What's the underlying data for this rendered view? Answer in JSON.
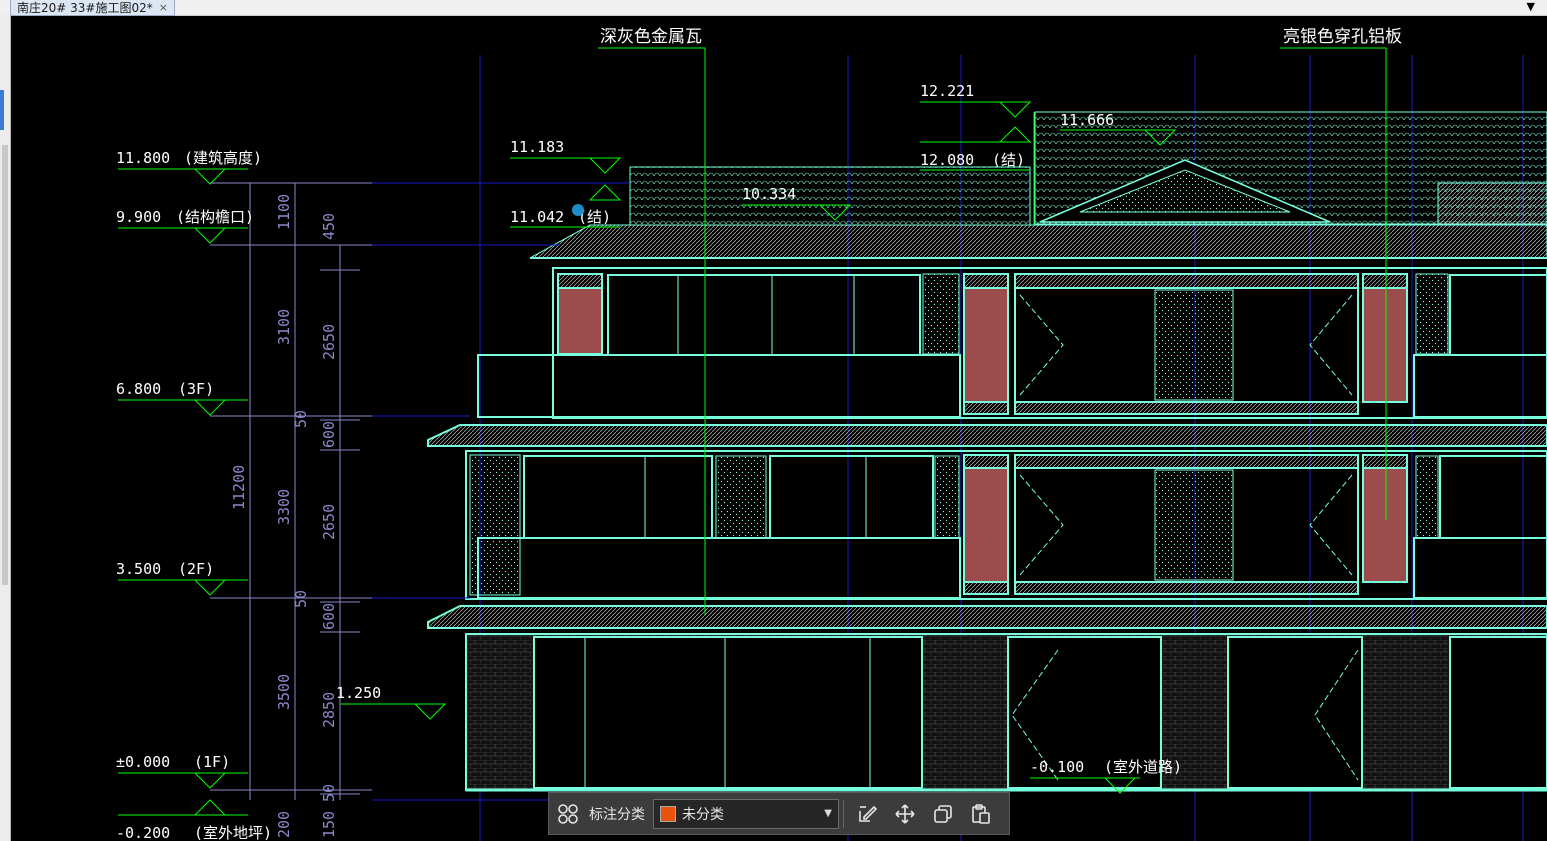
{
  "window": {
    "tab_title": "南庄20# 33#施工图02*",
    "tab_close": "×"
  },
  "drawing": {
    "materials": {
      "roof_tile": "深灰色金属瓦",
      "perforated_panel": "亮银色穿孔铝板"
    },
    "levels": {
      "building_height": "11.800",
      "building_height_note": "(建筑高度)",
      "eave": "9.900",
      "eave_note": "(结构檐口)",
      "f3": "6.800",
      "f3_note": "(3F)",
      "f2": "3.500",
      "f2_note": "(2F)",
      "f1": "±0.000",
      "f1_note": "(1F)",
      "ground": "-0.200",
      "ground_note": "(室外地坪)",
      "road": "-0.100",
      "road_note": "(室外道路)",
      "sill": "1.250",
      "r1": "11.183",
      "r2": "11.042",
      "r2_note": "(结)",
      "r3": "10.334",
      "r4": "12.221",
      "r5": "11.666",
      "r6": "12.080",
      "r6_note": "(结)"
    },
    "dims_outer": {
      "total": "11200"
    },
    "dims_mid": [
      "1100",
      "3100",
      "3300",
      "3500",
      "200"
    ],
    "dims_inner": [
      "450",
      "2650",
      "50",
      "600",
      "2650",
      "50",
      "600",
      "2850",
      "50",
      "150"
    ]
  },
  "toolbar": {
    "category_label": "标注分类",
    "category_value": "未分类",
    "swatch_color": "#e8530e",
    "icons": [
      "grid-icon",
      "edit-icon",
      "move-icon",
      "copy-icon",
      "paste-icon"
    ]
  },
  "colors": {
    "background": "#000000",
    "outline": "#7fffd4",
    "axis": "#1a1acc",
    "leader": "#00ff00",
    "dimension": "#8b87c9",
    "text": "#ffffff",
    "panel_red": "#9c4c4c"
  }
}
